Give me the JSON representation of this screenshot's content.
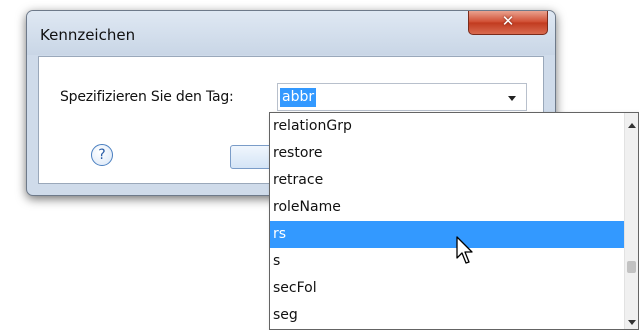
{
  "dialog": {
    "title": "Kennzeichen",
    "close_icon": "close-icon",
    "tag_label": "Spezifizieren Sie den Tag:",
    "combo_value": "abbr",
    "help_icon": "help-icon",
    "help_symbol": "?"
  },
  "dropdown": {
    "items": [
      "relationGrp",
      "restore",
      "retrace",
      "roleName",
      "rs",
      "s",
      "secFol",
      "seg"
    ],
    "selected_item": "rs"
  },
  "colors": {
    "selection": "#3399ff",
    "close_button": "#c13a1f"
  }
}
